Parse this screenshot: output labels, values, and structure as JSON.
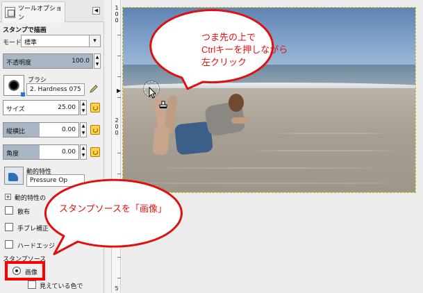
{
  "panel": {
    "tab_label": "ツールオプション",
    "menu_button": "◀",
    "title": "スタンプで描画",
    "mode_label": "モード:",
    "mode_value": "標準",
    "opacity_label": "不透明度",
    "opacity_value": "100.0",
    "opacity_fraction": 1.0,
    "brush_label": "ブラシ",
    "brush_value": "2. Hardness 075",
    "size_label": "サイズ",
    "size_value": "25.00",
    "aspect_label": "縦横比",
    "aspect_value": "0.00",
    "angle_label": "角度",
    "angle_value": "0.00",
    "dynamics_label": "動的特性",
    "dynamics_value": "Pressure Op",
    "dynamics_options_label": "動的特性の",
    "scatter_label": "散布",
    "smoothing_label": "手ブレ補正",
    "hard_edge_label": "ハードエッジ",
    "source_label": "スタンプソース",
    "source_image_label": "画像",
    "sample_merged_label": "見えている色で"
  },
  "ruler": {
    "numbers": [
      "1",
      "0",
      "0",
      "2",
      "0",
      "0",
      "5"
    ]
  },
  "callouts": {
    "top_line1": "つま先の上で",
    "top_line2": "Ctrlキーを押しながら",
    "top_line3": "左クリック",
    "bottom": "スタンプソースを「画像」"
  },
  "colors": {
    "callout_red": "#e01010",
    "highlight_red": "#ff0000"
  }
}
